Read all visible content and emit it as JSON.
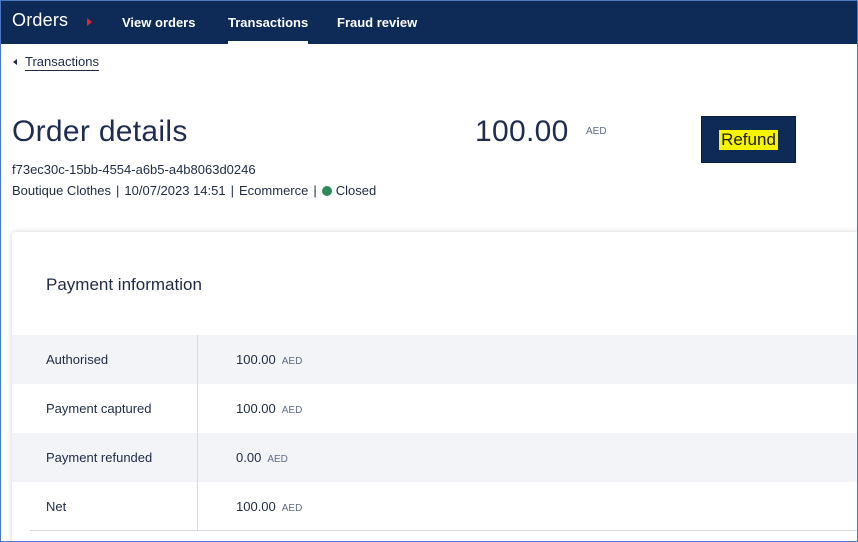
{
  "nav": {
    "brand": "Orders",
    "links": [
      "View orders",
      "Transactions",
      "Fraud review"
    ],
    "active": "Transactions"
  },
  "breadcrumb": {
    "label": "Transactions"
  },
  "order": {
    "title": "Order details",
    "id": "f73ec30c-15bb-4554-a6b5-a4b8063d0246",
    "merchant": "Boutique Clothes",
    "datetime": "10/07/2023 14:51",
    "channel": "Ecommerce",
    "status": "Closed",
    "status_color": "#2e8b57",
    "amount": "100.00",
    "currency": "AED",
    "refund_label": "Refund"
  },
  "payment": {
    "title": "Payment information",
    "rows": [
      {
        "label": "Authorised",
        "value": "100.00",
        "currency": "AED"
      },
      {
        "label": "Payment captured",
        "value": "100.00",
        "currency": "AED"
      },
      {
        "label": "Payment refunded",
        "value": "0.00",
        "currency": "AED"
      },
      {
        "label": "Net",
        "value": "100.00",
        "currency": "AED"
      }
    ]
  },
  "colors": {
    "nav_bg": "#0e2a56",
    "brand_accent": "#e5262b",
    "refund_highlight": "#f6f400"
  },
  "icons": {
    "brand_caret": "caret-right-icon",
    "breadcrumb_caret": "caret-left-icon",
    "status": "status-dot-icon"
  }
}
